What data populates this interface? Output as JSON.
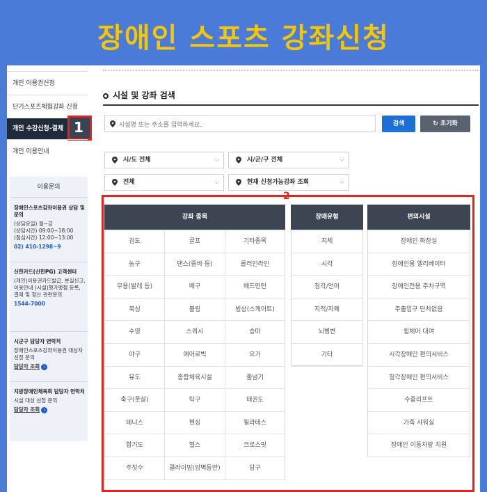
{
  "banner": {
    "title": "장애인 스포츠 강좌신청"
  },
  "sidebar": {
    "items": [
      {
        "label": "개인 이용권신청"
      },
      {
        "label": "단기스포츠체험강좌 신청"
      },
      {
        "label": "개인 수강신청-결제"
      },
      {
        "label": "개인 이용안내"
      }
    ],
    "active_marker": "1"
  },
  "inquiry": {
    "title": "이용문의",
    "block1": {
      "title": "장애인스포츠강좌이용권 상담 및 문의",
      "line1": "(상담요일) 월~금",
      "line2": "(상담시간) 09:00~18:00",
      "line3": "(점심시간) 12:00~13:00",
      "phone": "02) 410-1298~9"
    },
    "block2": {
      "title": "신한카드(신한PG) 고객센터",
      "desc": "(개인)이용권카드발급, 분실신고, 이용안내 (시설)행가맹점 등록, 결제 및 정산 관련문의",
      "phone": "1544-7000"
    },
    "block3": {
      "title": "시군구 담당자 연락처",
      "desc": "장애인스포츠강좌이용권 대상자 선정 문의",
      "link": "담당자 조회"
    },
    "block4": {
      "title": "지방장애인체육회 담당자 연락처",
      "desc": "시설 대상 선정 문의",
      "link": "담당자 조회"
    }
  },
  "search": {
    "section_title": "시설 및 강좌 검색",
    "placeholder": "시설명 또는 주소를 입력하세요.",
    "search_label": "검색",
    "reset_label": "초기화"
  },
  "filters": {
    "sido": "시/도 전체",
    "sigungu": "시/군/구 전체",
    "type": "전체",
    "status": "현재 신청가능강좌 조회"
  },
  "annotation_label": "2",
  "columns": {
    "sports_header": "강좌 종목",
    "disability_header": "장애유형",
    "facility_header": "편의시설"
  },
  "sports": [
    [
      "검도",
      "골프",
      "기타종목"
    ],
    [
      "농구",
      "댄스(줌바 등)",
      "롤러인라인"
    ],
    [
      "무용(발레 등)",
      "배구",
      "배드민턴"
    ],
    [
      "복싱",
      "볼링",
      "빙상(스케이트)"
    ],
    [
      "수영",
      "스쿼시",
      "승마"
    ],
    [
      "야구",
      "에어로빅",
      "요가"
    ],
    [
      "유도",
      "종합체육시설",
      "줄넘기"
    ],
    [
      "축구(풋살)",
      "탁구",
      "태권도"
    ],
    [
      "테니스",
      "펜싱",
      "필라테스"
    ],
    [
      "합기도",
      "헬스",
      "크로스핏"
    ],
    [
      "주짓수",
      "클라이밍(암벽등반)",
      "당구"
    ]
  ],
  "disabilities": [
    "지체",
    "시각",
    "청각/언어",
    "지적/자폐",
    "뇌병변",
    "기타"
  ],
  "facilities": [
    "장애인 화장실",
    "장애인용 엘리베이터",
    "장애인전용 주차구역",
    "주출입구 단차없음",
    "휠체어 대여",
    "시각장애인 편의서비스",
    "청각장애인 편의서비스",
    "수중리프트",
    "가족 샤워실",
    "장애인 이동차량 지원"
  ],
  "colors": {
    "banner_bg": "#4a7bd8",
    "title_yellow": "#f6c700",
    "header_dark": "#3d4553",
    "search_blue": "#1d6fd6",
    "highlight_red": "#e8211c"
  }
}
